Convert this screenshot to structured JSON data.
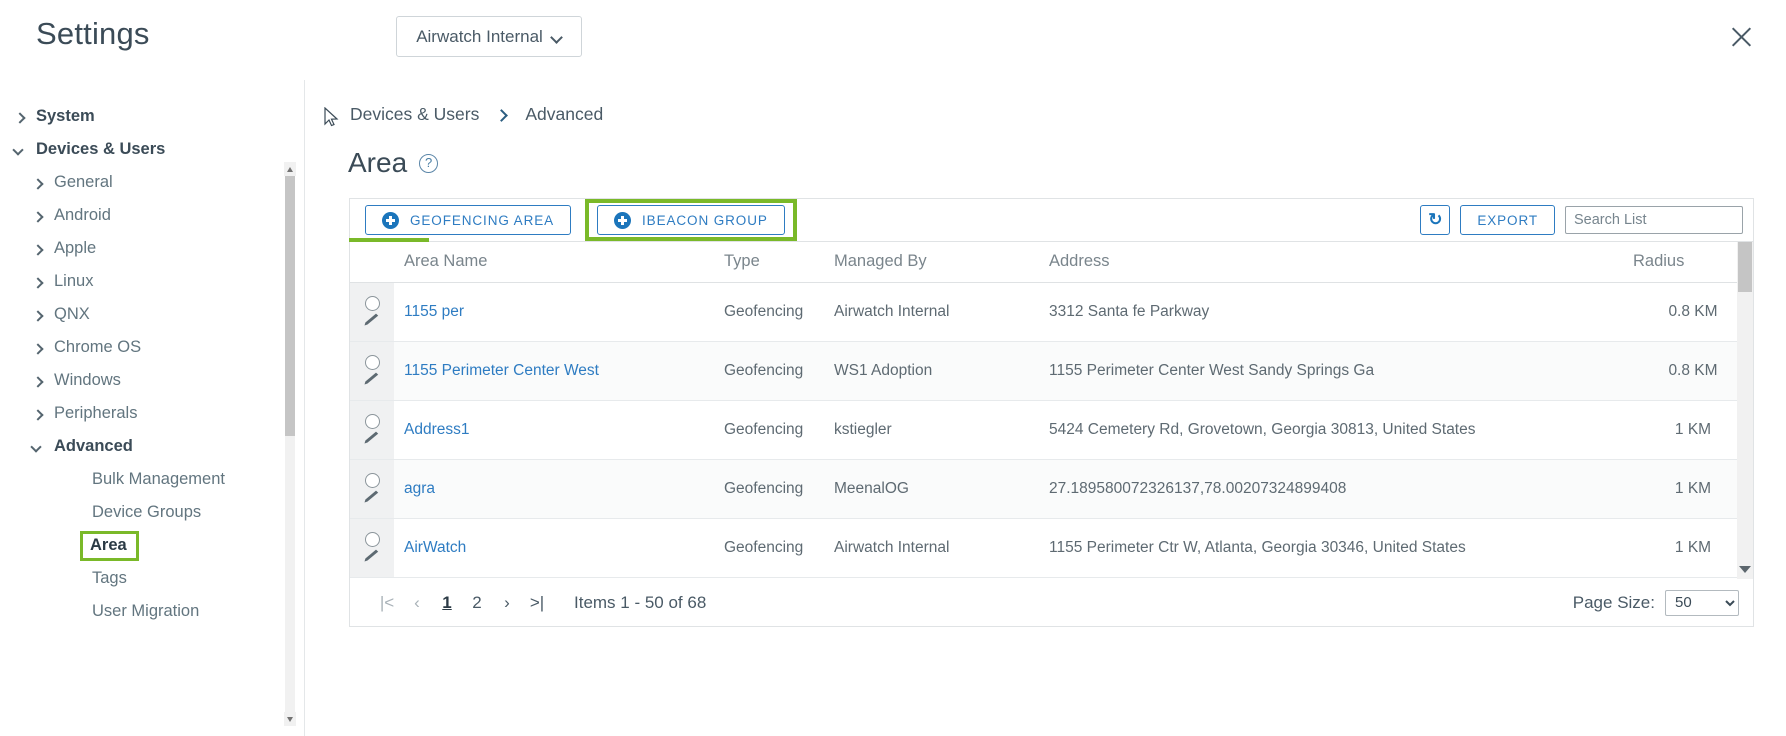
{
  "header": {
    "title": "Settings",
    "org_selector": {
      "label": "Airwatch Internal",
      "chevron_icon": "chevron-down-icon"
    },
    "close_icon": "close-icon"
  },
  "sidebar": {
    "items": [
      {
        "label": "System",
        "level": 0,
        "caret": "right",
        "selected": false
      },
      {
        "label": "Devices & Users",
        "level": 0,
        "caret": "down",
        "selected": false
      },
      {
        "label": "General",
        "level": 1,
        "caret": "right",
        "selected": false
      },
      {
        "label": "Android",
        "level": 1,
        "caret": "right",
        "selected": false
      },
      {
        "label": "Apple",
        "level": 1,
        "caret": "right",
        "selected": false
      },
      {
        "label": "Linux",
        "level": 1,
        "caret": "right",
        "selected": false
      },
      {
        "label": "QNX",
        "level": 1,
        "caret": "right",
        "selected": false
      },
      {
        "label": "Chrome OS",
        "level": 1,
        "caret": "right",
        "selected": false
      },
      {
        "label": "Windows",
        "level": 1,
        "caret": "right",
        "selected": false
      },
      {
        "label": "Peripherals",
        "level": 1,
        "caret": "right",
        "selected": false
      },
      {
        "label": "Advanced",
        "level": 1,
        "caret": "down",
        "selected": false,
        "bold": true
      },
      {
        "label": "Bulk Management",
        "level": 2,
        "caret": "none",
        "selected": false
      },
      {
        "label": "Device Groups",
        "level": 2,
        "caret": "none",
        "selected": false
      },
      {
        "label": "Area",
        "level": 2,
        "caret": "none",
        "selected": true
      },
      {
        "label": "Tags",
        "level": 2,
        "caret": "none",
        "selected": false
      },
      {
        "label": "User Migration",
        "level": 2,
        "caret": "none",
        "selected": false
      }
    ],
    "scrollbar": {
      "up_icon": "scroll-up-icon",
      "down_icon": "scroll-down-icon"
    }
  },
  "main": {
    "breadcrumb": {
      "crumb1": "Devices & Users",
      "separator_icon": "chevron-right-icon",
      "crumb2": "Advanced"
    },
    "page_title": "Area",
    "help_icon_glyph": "?",
    "toolbar": {
      "geofencing_button": {
        "label": "GEOFENCING AREA",
        "icon": "plus-circle-icon"
      },
      "ibeacon_button": {
        "label": "IBEACON GROUP",
        "icon": "plus-circle-icon",
        "highlighted": true
      },
      "refresh_button": {
        "glyph": "↻",
        "icon": "refresh-icon"
      },
      "export_button": {
        "label": "EXPORT"
      },
      "search": {
        "placeholder": "Search List",
        "value": ""
      }
    },
    "table": {
      "columns": [
        "Area Name",
        "Type",
        "Managed By",
        "Address",
        "Radius"
      ],
      "rows": [
        {
          "name": "1155 per",
          "type": "Geofencing",
          "managed_by": "Airwatch Internal",
          "address": "3312 Santa fe Parkway",
          "radius": "0.8 KM"
        },
        {
          "name": "1155 Perimeter Center West",
          "type": "Geofencing",
          "managed_by": "WS1 Adoption",
          "address": "1155 Perimeter Center West Sandy Springs Ga",
          "radius": "0.8 KM"
        },
        {
          "name": "Address1",
          "type": "Geofencing",
          "managed_by": "kstiegler",
          "address": "5424 Cemetery Rd, Grovetown, Georgia 30813, United States",
          "radius": "1 KM"
        },
        {
          "name": "agra",
          "type": "Geofencing",
          "managed_by": "MeenalOG",
          "address": "27.189580072326137,78.00207324899408",
          "radius": "1 KM"
        },
        {
          "name": "AirWatch",
          "type": "Geofencing",
          "managed_by": "Airwatch Internal",
          "address": "1155 Perimeter Ctr W, Atlanta, Georgia 30346, United States",
          "radius": "1 KM"
        }
      ],
      "row_select_icon": "radio-button-icon",
      "row_edit_icon": "pencil-icon"
    },
    "footer": {
      "first_page_label": "|<",
      "prev_page_label": "‹",
      "pages": [
        "1",
        "2"
      ],
      "current_page": "1",
      "next_page_label": "›",
      "last_page_label": ">|",
      "items_text": "Items 1 - 50 of 68",
      "page_size_label": "Page Size:",
      "page_size_value": "50"
    }
  },
  "colors": {
    "accent_green": "#7ab929",
    "link_blue": "#2e7cc2",
    "text_dark": "#2b3a45",
    "text_muted": "#7a858c"
  }
}
